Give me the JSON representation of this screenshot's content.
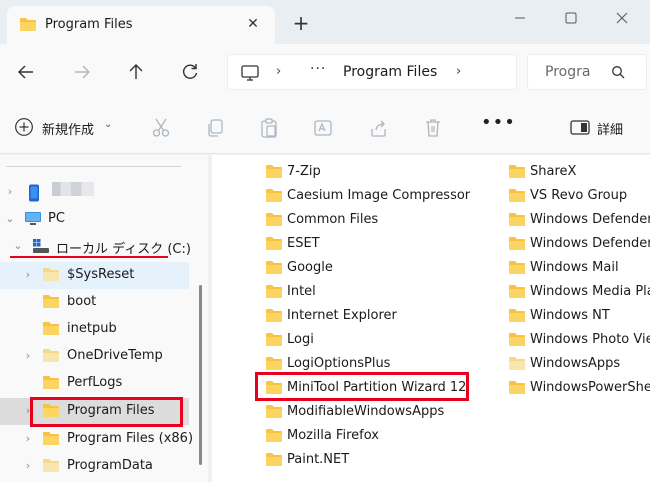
{
  "window": {
    "tab_title": "Program Files",
    "close_tab": "✕",
    "new_tab": "+"
  },
  "address": {
    "crumb": "Program Files",
    "search_placeholder": "Progra"
  },
  "commands": {
    "new_label": "新規作成",
    "details_label": "詳細"
  },
  "sidebar": {
    "pc_label": "PC",
    "drive_label": "ローカル ディスク (C:)",
    "items": [
      {
        "label": "$SysReset",
        "icon": "folder-light"
      },
      {
        "label": "boot",
        "icon": "folder"
      },
      {
        "label": "inetpub",
        "icon": "folder"
      },
      {
        "label": "OneDriveTemp",
        "icon": "folder-light"
      },
      {
        "label": "PerfLogs",
        "icon": "folder"
      },
      {
        "label": "Program Files",
        "icon": "folder"
      },
      {
        "label": "Program Files (x86)",
        "icon": "folder"
      },
      {
        "label": "ProgramData",
        "icon": "folder-light"
      }
    ]
  },
  "files": {
    "col1": [
      "7-Zip",
      "Caesium Image Compressor",
      "Common Files",
      "ESET",
      "Google",
      "Intel",
      "Internet Explorer",
      "Logi",
      "LogiOptionsPlus",
      "MiniTool Partition Wizard 12",
      "ModifiableWindowsApps",
      "Mozilla Firefox",
      "Paint.NET"
    ],
    "col2": [
      "ShareX",
      "VS Revo Group",
      "Windows Defender",
      "Windows Defender Advanced Threat Protection",
      "Windows Mail",
      "Windows Media Player",
      "Windows NT",
      "Windows Photo Viewer",
      "WindowsApps",
      "WindowsPowerShell"
    ]
  },
  "colors": {
    "highlight": "#e8001c",
    "folder": "#f6c342",
    "accent": "#0067c0"
  }
}
